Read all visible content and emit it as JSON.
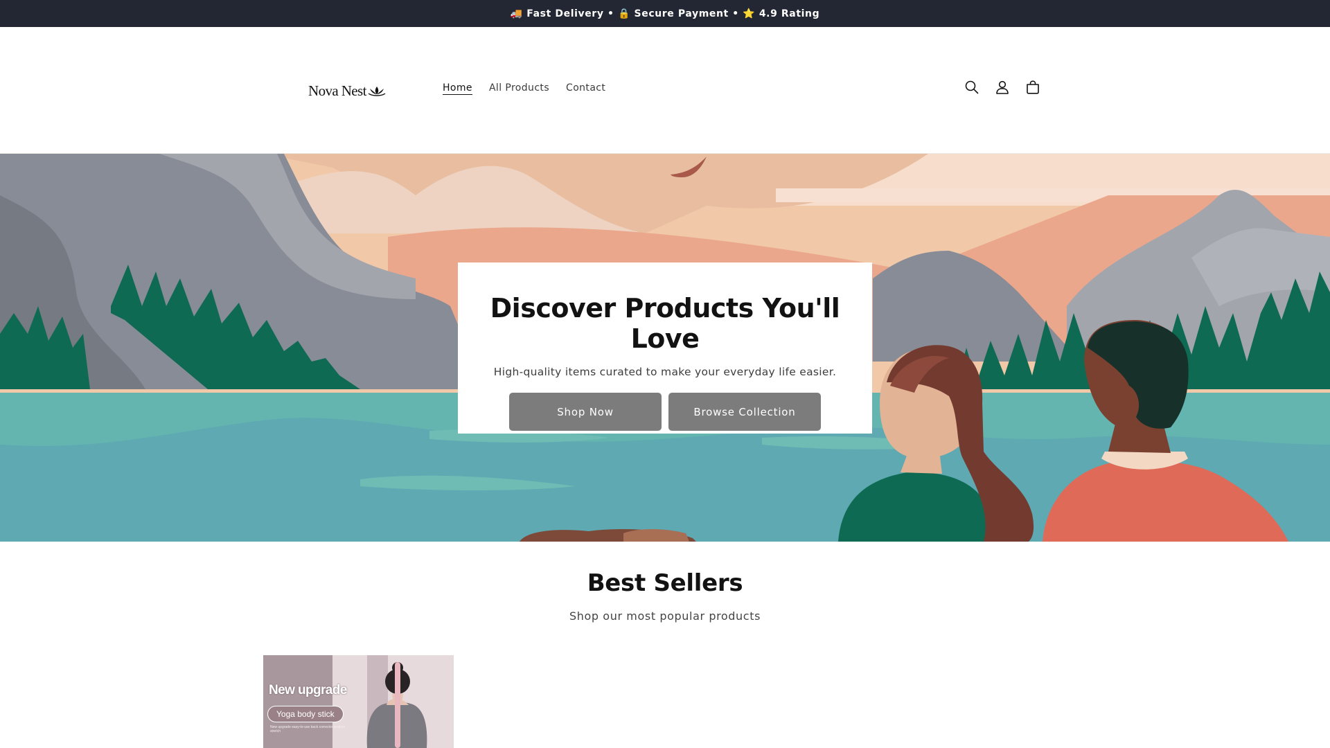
{
  "announcement": {
    "text": "🚚 Fast Delivery • 🔒 Secure Payment • ⭐ 4.9 Rating"
  },
  "header": {
    "logo_text": "Nova Nest",
    "logo_icon": "lotus-icon",
    "nav": [
      {
        "label": "Home",
        "active": true
      },
      {
        "label": "All Products",
        "active": false
      },
      {
        "label": "Contact",
        "active": false
      }
    ],
    "icons": [
      "search-icon",
      "account-icon",
      "cart-icon"
    ]
  },
  "hero": {
    "title": "Discover Products You'll Love",
    "subtitle": "High-quality items curated to make your everyday life easier.",
    "buttons": {
      "primary": "Shop Now",
      "secondary": "Browse Collection"
    }
  },
  "best_sellers": {
    "title": "Best Sellers",
    "subtitle": "Shop our most popular products",
    "products": [
      {
        "image_headline": "New upgrade",
        "image_tag": "Yoga body stick",
        "image_fine_print": "New upgrade easy-to-use back corrector posture stretch"
      }
    ]
  },
  "colors": {
    "announcement_bg": "#232733",
    "button_bg": "#7c7c7c",
    "hero_sky": "#f1c9a8",
    "hero_water": "#5ea9b2",
    "hero_forest": "#0e6a52"
  }
}
